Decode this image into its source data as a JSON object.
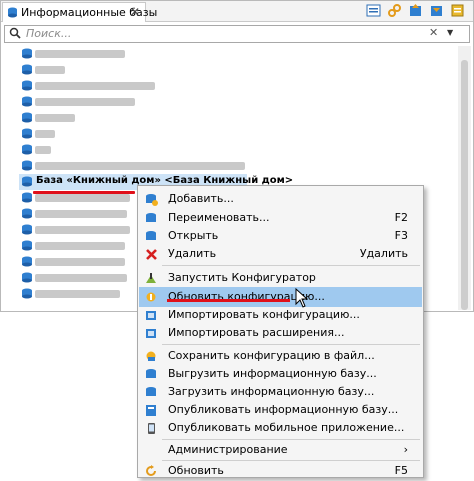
{
  "tab": {
    "title": "Информационные базы",
    "close": "✕"
  },
  "search": {
    "placeholder": "Поиск...",
    "clear": "✕",
    "dropdown": "▼"
  },
  "list": {
    "selected": {
      "text": "База «Книжный дом» <База Книжный дом>"
    },
    "blurred_widths": [
      90,
      60,
      120,
      100,
      110,
      70,
      80,
      70,
      40,
      150,
      130,
      160
    ]
  },
  "menu": {
    "items": [
      {
        "label": "Добавить...",
        "shortcut": "",
        "icon": "add-icon"
      },
      {
        "label": "Переименовать...",
        "shortcut": "F2",
        "icon": "rename-icon"
      },
      {
        "label": "Открыть",
        "shortcut": "F3",
        "icon": "open-icon"
      },
      {
        "label": "Удалить",
        "shortcut": "Удалить",
        "icon": "delete-icon"
      },
      {
        "label": "Запустить Конфигуратор",
        "shortcut": "",
        "icon": "configurator-icon"
      },
      {
        "label": "Обновить конфигурацию...",
        "shortcut": "",
        "icon": "update-config-icon"
      },
      {
        "label": "Импортировать конфигурацию...",
        "shortcut": "",
        "icon": "import-config-icon"
      },
      {
        "label": "Импортировать расширения...",
        "shortcut": "",
        "icon": "import-ext-icon"
      },
      {
        "label": "Сохранить конфигурацию в файл...",
        "shortcut": "",
        "icon": "save-config-icon"
      },
      {
        "label": "Выгрузить информационную базу...",
        "shortcut": "",
        "icon": "export-db-icon"
      },
      {
        "label": "Загрузить информационную базу...",
        "shortcut": "",
        "icon": "load-db-icon"
      },
      {
        "label": "Опубликовать информационную базу...",
        "shortcut": "",
        "icon": "publish-db-icon"
      },
      {
        "label": "Опубликовать мобильное приложение...",
        "shortcut": "",
        "icon": "publish-mobile-icon"
      },
      {
        "label": "Администрирование",
        "shortcut": "›",
        "icon": ""
      },
      {
        "label": "Обновить",
        "shortcut": "F5",
        "icon": "refresh-icon"
      }
    ]
  },
  "colors": {
    "accent_red": "#e0101a",
    "hover": "#9fc9ef",
    "db_icon": "#2f7fd0"
  }
}
